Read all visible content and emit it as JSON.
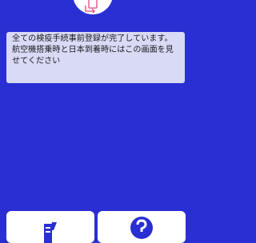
{
  "message": {
    "text": "全ての検疫手続事前登録が完了しています。航空機搭乗時と日本到着時にはこの画面を見せてください"
  },
  "icons": {
    "top": "document-swap-icon",
    "left_card": "document-pen-icon",
    "right_card": "question-icon"
  },
  "colors": {
    "background": "#2a2fd3",
    "card": "#d8daf6",
    "icon_accent": "#e0477a",
    "icon_primary": "#2a2fd3"
  }
}
